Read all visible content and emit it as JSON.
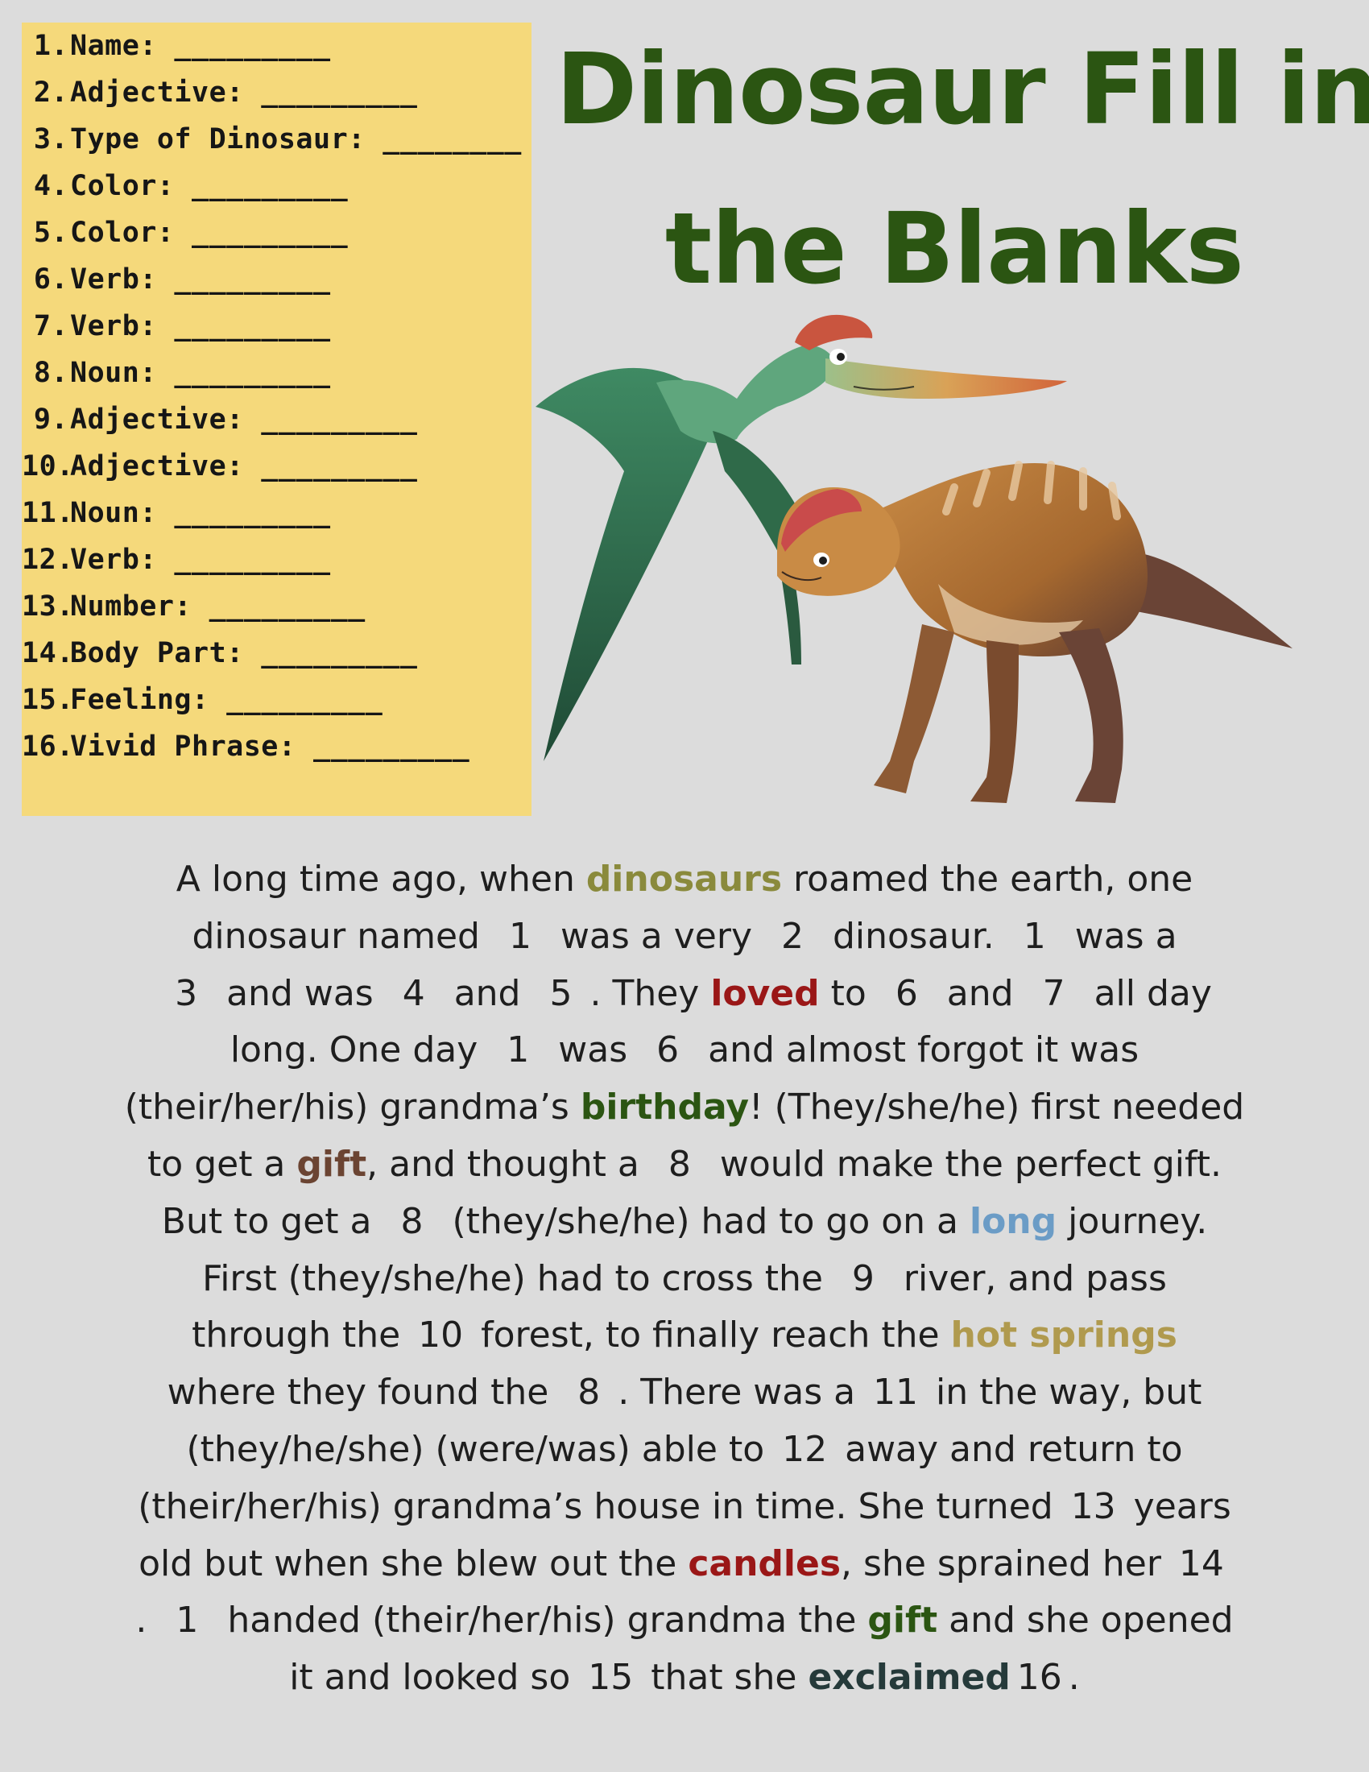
{
  "title": {
    "line1": "Dinosaur Fill in",
    "line2": "the Blanks"
  },
  "word_list": [
    {
      "num": "1.",
      "label": "Name: _________"
    },
    {
      "num": "2.",
      "label": "Adjective: _________"
    },
    {
      "num": "3.",
      "label": "Type of Dinosaur: ________"
    },
    {
      "num": "4.",
      "label": "Color: _________"
    },
    {
      "num": "5.",
      "label": "Color: _________"
    },
    {
      "num": "6.",
      "label": "Verb: _________"
    },
    {
      "num": "7.",
      "label": "Verb: _________"
    },
    {
      "num": "8.",
      "label": "Noun: _________"
    },
    {
      "num": "9.",
      "label": "Adjective: _________"
    },
    {
      "num": "10.",
      "label": "Adjective: _________"
    },
    {
      "num": "11.",
      "label": "Noun: _________"
    },
    {
      "num": "12.",
      "label": "Verb: _________"
    },
    {
      "num": "13.",
      "label": "Number: _________"
    },
    {
      "num": "14.",
      "label": "Body Part: _________"
    },
    {
      "num": "15.",
      "label": "Feeling: _________"
    },
    {
      "num": "16.",
      "label": "Vivid Phrase: _________"
    }
  ],
  "colors": {
    "title": "#2b5512",
    "list_background": "#f5d97b",
    "page_background": "#dcdcdc",
    "olive": "#8a8a3c",
    "dark_red": "#9a1717",
    "dark_green": "#2b5512",
    "brown": "#6b4432",
    "blue": "#6b9cc6",
    "tan": "#b09a4e",
    "slate": "#253a3a"
  },
  "story": {
    "l1": {
      "a": "A long time ago, when ",
      "b": "dinosaurs",
      "c": " roamed the earth, one"
    },
    "l2": {
      "a": "dinosaur named ",
      "n1": "1",
      "b": " was a very ",
      "n2": "2",
      "c": " dinosaur. ",
      "n3": "1",
      "d": " was a"
    },
    "l3": {
      "n1": "3",
      "a": " and was ",
      "n2": "4",
      "b": " and ",
      "n3": "5",
      "c": ". They ",
      "h": "loved",
      "d": " to ",
      "n4": "6",
      "e": " and ",
      "n5": "7",
      "f": " all day"
    },
    "l4": {
      "a": "long. One day ",
      "n1": "1",
      "b": " was ",
      "n2": "6",
      "c": " and almost forgot it was"
    },
    "l5": {
      "a": "(their/her/his) grandma’s ",
      "h": "birthday",
      "b": "! (They/she/he) first needed"
    },
    "l6": {
      "a": "to get a ",
      "h": "gift",
      "b": ", and thought a ",
      "n1": "8",
      "c": " would make the perfect gift."
    },
    "l7": {
      "a": "But to get a ",
      "n1": "8",
      "b": " (they/she/he) had to go on a ",
      "h": "long",
      "c": " journey."
    },
    "l8": {
      "a": "First (they/she/he) had to cross the ",
      "n1": "9",
      "b": " river, and pass"
    },
    "l9": {
      "a": "through the ",
      "n1": "10",
      "b": " forest, to finally reach the ",
      "h": "hot springs"
    },
    "l10": {
      "a": "where they found the ",
      "n1": "8",
      "b": ". There was a ",
      "n2": "11",
      "c": " in the way, but"
    },
    "l11": {
      "a": "(they/he/she) (were/was) able to ",
      "n1": "12",
      "b": " away and return to"
    },
    "l12": {
      "a": "(their/her/his) grandma’s house in time. She turned ",
      "n1": "13",
      "b": " years"
    },
    "l13": {
      "a": "old but when she blew out the ",
      "h": "candles",
      "b": ", she sprained her ",
      "n1": "14"
    },
    "l14": {
      "a": ". ",
      "n1": "1",
      "b": " handed (their/her/his) grandma the ",
      "h": "gift",
      "c": " and she opened"
    },
    "l15": {
      "a": "it and looked so ",
      "n1": "15",
      "b": " that she ",
      "h": "exclaimed",
      "n2": "16",
      "c": "."
    }
  }
}
